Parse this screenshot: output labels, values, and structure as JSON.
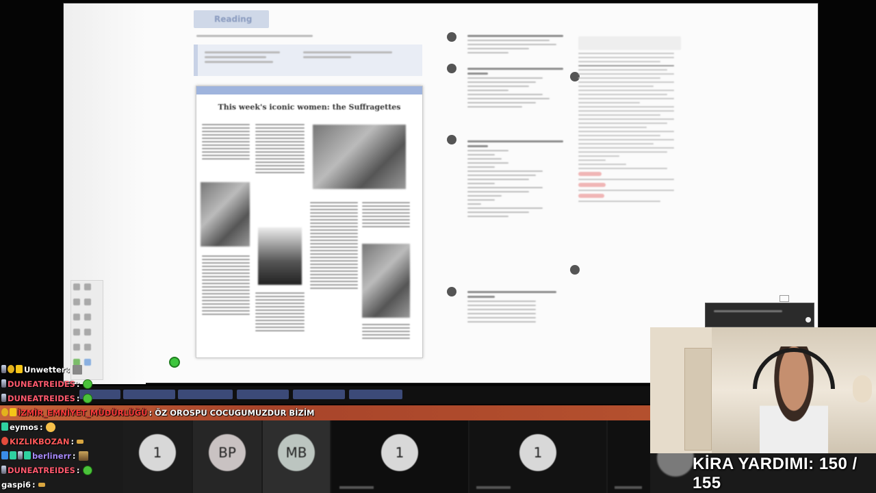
{
  "document": {
    "section_title": "Reading",
    "article_headline": "This week's iconic women: the Suffragettes"
  },
  "overlay": {
    "rent_label": "KİRA YARDIMI:",
    "rent_value": "150 / 155"
  },
  "video_tiles": [
    {
      "label": "1"
    },
    {
      "label": "BP"
    },
    {
      "label": "MB"
    },
    {
      "label": "1"
    },
    {
      "label": "1"
    }
  ],
  "chat": {
    "messages": [
      {
        "user": "Unwetter",
        "color": "#ffffff",
        "badges": [
          "sword",
          "gold",
          "yellow"
        ],
        "text": "",
        "emote": "box"
      },
      {
        "user": "DUNEATREIDES",
        "color": "#ff5a6e",
        "badges": [
          "sword"
        ],
        "text": "",
        "emote": "green"
      },
      {
        "user": "DUNEATREIDES",
        "color": "#ff5a6e",
        "badges": [
          "sword"
        ],
        "text": "",
        "emote": "green"
      },
      {
        "user": "İZMİR_EMNİYET_MÜDÜRLÜĞÜ",
        "color": "#ff3b3b",
        "badges": [
          "gold",
          "yellow"
        ],
        "text": "ÖZ OROSPU COCUGUMUZDUR BİZİM",
        "emote": ""
      },
      {
        "user": "eymos",
        "color": "#ffffff",
        "badges": [
          "green"
        ],
        "text": "",
        "emote": "face"
      },
      {
        "user": "KIZLIKBOZAN",
        "color": "#ff5a5a",
        "badges": [
          "red"
        ],
        "text": "",
        "emote": "tiny"
      },
      {
        "user": "berlinerr",
        "color": "#a98bff",
        "badges": [
          "blue",
          "green",
          "sword",
          "green"
        ],
        "text": "",
        "emote": "pepe"
      },
      {
        "user": "DUNEATREIDES",
        "color": "#ff5a6e",
        "badges": [
          "sword"
        ],
        "text": "",
        "emote": "green"
      },
      {
        "user": "gaspi6",
        "color": "#ffffff",
        "badges": [],
        "text": "",
        "emote": "tiny"
      }
    ]
  }
}
